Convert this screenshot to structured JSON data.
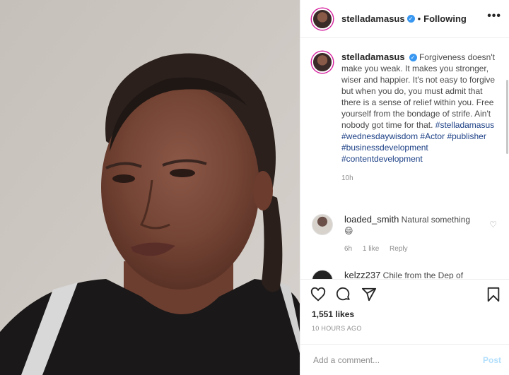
{
  "header": {
    "username": "stelladamasus",
    "separator": "•",
    "follow_status": "Following",
    "more_label": "•••"
  },
  "caption": {
    "username": "stelladamasus",
    "text": "Forgiveness doesn't make you weak. It makes you stronger, wiser and happier. It's not easy to forgive but when you do, you must admit that there is a sense of relief within you. Free yourself from the bondage of strife. Ain't nobody got time for that.",
    "hashtags": [
      "#stelladamasus",
      "#wednesdaywisdom",
      "#Actor",
      "#publisher",
      "#businessdevelopment",
      "#contentdevelopment"
    ],
    "age": "10h"
  },
  "comments": [
    {
      "username": "loaded_smith",
      "text": "Natural something 😄",
      "age": "6h",
      "likes": "1 like",
      "reply": "Reply"
    },
    {
      "username": "kelzz237",
      "text": "Chile from the Dep of"
    }
  ],
  "post": {
    "likes": "1,551 likes",
    "timestamp": "10 HOURS AGO"
  },
  "add_comment": {
    "placeholder": "Add a comment...",
    "post_label": "Post"
  },
  "icons": [
    "heart-icon",
    "comment-icon",
    "share-icon",
    "bookmark-icon",
    "verified-badge-icon"
  ],
  "colors": {
    "link": "#1b3f85",
    "verified": "#3897f0",
    "post_disabled": "#b2dffc"
  }
}
